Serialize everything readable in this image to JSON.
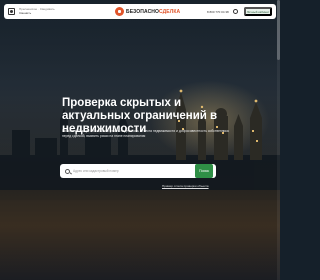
{
  "header": {
    "location_label": "Пресненское · Сведивать",
    "location_change": "Сменить",
    "brand_part1": "БЕЗОПАСНО",
    "brand_part2": "СДЕЛКА",
    "phone": "8 800 770 04 38",
    "cabinet_button": "Личный кабинет"
  },
  "hero": {
    "title": "Проверка скрытых и актуальных ограничений в недвижимости",
    "lead": "Помогаем быстро и безопасно узнать надежность объекта недвижимости и добросовестность собственника перед сделкой, выявить риски на этапе планирования"
  },
  "search": {
    "placeholder": "Адрес или кадастровый номер",
    "button": "Поиск",
    "example_link": "Пример отчета проверки объекта"
  },
  "colors": {
    "accent_green": "#2f8f46",
    "brand_orange": "#e0552b"
  },
  "icons": {
    "location": "map-pin-icon",
    "brand": "shield-logo-icon",
    "user": "user-icon",
    "search": "search-icon"
  }
}
